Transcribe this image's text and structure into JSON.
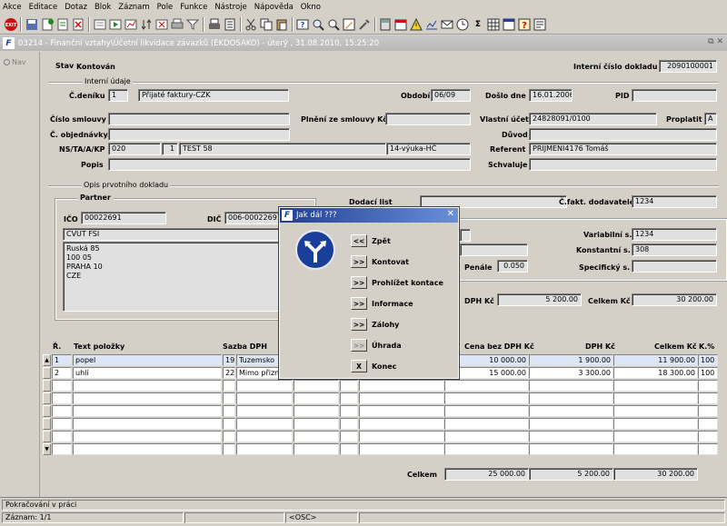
{
  "menu": [
    "Akce",
    "Editace",
    "Dotaz",
    "Blok",
    "Záznam",
    "Pole",
    "Funkce",
    "Nástroje",
    "Nápověda",
    "Okno"
  ],
  "window": {
    "title": "03214 - Finanční vztahy\\Účetní likvidace závazků (EKDOSAKO) - úterý , 31.08.2010, 15:25:20"
  },
  "nav": {
    "label": "Nav"
  },
  "header": {
    "stav_label": "Stav",
    "stav_value": "Kontován",
    "doc_label": "Interní číslo dokladu",
    "doc_value": "2090100001",
    "interni_udaje": "Interní údaje",
    "cdeniku_label": "Č.deníku",
    "cdeniku_value": "1",
    "cdeniku_name": "Přijaté faktury-CZK",
    "obdobi_label": "Období",
    "obdobi_value": "06/09",
    "doslo_label": "Došlo dne",
    "doslo_value": "16.01.2006",
    "pid_label": "PID",
    "pid_value": "",
    "smlouvy_label": "Číslo smlouvy",
    "smlouvy_value": "",
    "plneni_label": "Plnění ze smlouvy Kč",
    "plneni_value": "",
    "vlastni_label": "Vlastní účet",
    "vlastni_value": "24828091/0100",
    "proplatit_label": "Proplatit",
    "proplatit_value": "A",
    "objednavky_label": "Č. objednávky.",
    "objednavky_value": "",
    "duvod_label": "Důvod",
    "duvod_value": "",
    "nsta_label": "NS/TA/A/KP",
    "ns_value": "020",
    "ta_value": "1",
    "a_value": "TEST 58",
    "kp_value": "14-výuka-HČ",
    "referent_label": "Referent",
    "referent_value": "PRIJMENI4176 Tomáš",
    "popis_label": "Popis",
    "popis_value": "",
    "schvaluje_label": "Schvaluje",
    "schvaluje_value": ""
  },
  "opis": {
    "section": "Opis prvotního dokladu",
    "partner_label": "Partner",
    "ico_label": "IČO",
    "ico_value": "00022691",
    "dic_label": "DIČ",
    "dic_value": "006-00022691",
    "name": "CVUT FSI",
    "address": [
      "Ruská 85",
      "100 05",
      "PRAHA 10",
      "CZE"
    ],
    "dodaci_label": "Dodací list",
    "dodaci_value": "",
    "cfakt_label": "Č.fakt. dodavatele",
    "cfakt_value": "1234",
    "variabilni_label": "Variabilní s.",
    "variabilni_value": "1234",
    "konstantni_label": "Konstantní s.",
    "konstantni_value": "308",
    "specificky_label": "Specifický s.",
    "specificky_value": "",
    "penale_label": "Penále",
    "penale_value": "0.050",
    "dph_label": "DPH Kč",
    "dph_value": "5 200.00",
    "celkem_label": "Celkem Kč",
    "celkem_value": "30 200.00"
  },
  "table": {
    "headers": {
      "r": "Ř.",
      "text": "Text položky",
      "sazba": "Sazba DPH",
      "cena": "Cena bez DPH Kč",
      "dph": "DPH Kč",
      "celkem": "Celkem Kč",
      "k": "K.%"
    },
    "rows": [
      {
        "r": "1",
        "text": "popel",
        "sazba": "19",
        "sazba_name": "Tuzemsko",
        "cena": "10 000.00",
        "dph": "1 900.00",
        "celkem": "11 900.00",
        "k": "100"
      },
      {
        "r": "2",
        "text": "uhlí",
        "sazba": "22",
        "sazba_name": "Mimo přizně",
        "cena": "15 000.00",
        "dph": "3 300.00",
        "celkem": "18 300.00",
        "k": "100"
      }
    ],
    "total_label": "Celkem",
    "total_cena": "25 000.00",
    "total_dph": "5 200.00",
    "total_celkem": "30 200.00"
  },
  "dialog": {
    "title": "Jak dál ???",
    "buttons": [
      {
        "glyph": "<<",
        "label": "Zpět"
      },
      {
        "glyph": ">>",
        "label": "Kontovat"
      },
      {
        "glyph": ">>",
        "label": "Prohlížet kontace"
      },
      {
        "glyph": ">>",
        "label": "Informace"
      },
      {
        "glyph": ">>",
        "label": "Zálohy"
      },
      {
        "glyph": ">>",
        "label": "Úhrada"
      },
      {
        "glyph": "X",
        "label": "Konec"
      }
    ]
  },
  "status": {
    "message": "Pokračování v práci",
    "record": "Záznam: 1/1",
    "mode": "<OSC>"
  }
}
